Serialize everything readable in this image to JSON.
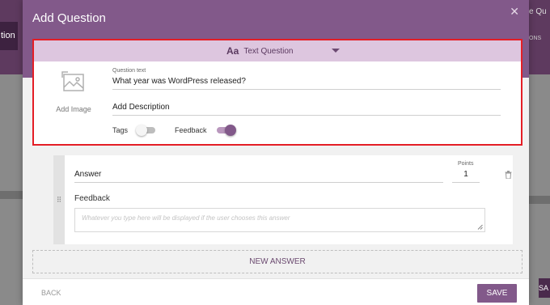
{
  "background": {
    "left_button_label": "tion",
    "right_button_label": "e Qu",
    "right_label": "ONS",
    "right_save_label": "SA"
  },
  "modal": {
    "title": "Add Question",
    "close_icon": "✕"
  },
  "question": {
    "type_icon_text": "Aa",
    "type_label": "Text Question",
    "text_label": "Question text",
    "text_value": "What year was WordPress released?",
    "add_description": "Add Description",
    "add_image_label": "Add Image",
    "tags_label": "Tags",
    "tags_on": false,
    "feedback_label": "Feedback",
    "feedback_on": true
  },
  "answer": {
    "drag_icon": "⠿",
    "value": "Answer",
    "points_label": "Points",
    "points_value": "1",
    "feedback_label": "Feedback",
    "feedback_placeholder": "Whatever you type here will be displayed if the user chooses this answer"
  },
  "new_answer_label": "NEW ANSWER",
  "footer": {
    "back_label": "BACK",
    "save_label": "SAVE"
  },
  "colors": {
    "brand": "#82598a",
    "header_light": "#ddc6df",
    "highlight_border": "#e41e26"
  }
}
